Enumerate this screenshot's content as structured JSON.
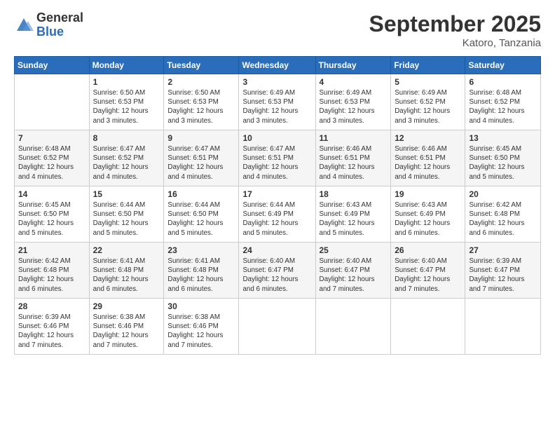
{
  "logo": {
    "general": "General",
    "blue": "Blue"
  },
  "title": "September 2025",
  "location": "Katoro, Tanzania",
  "days_of_week": [
    "Sunday",
    "Monday",
    "Tuesday",
    "Wednesday",
    "Thursday",
    "Friday",
    "Saturday"
  ],
  "weeks": [
    [
      {
        "day": "",
        "info": ""
      },
      {
        "day": "1",
        "info": "Sunrise: 6:50 AM\nSunset: 6:53 PM\nDaylight: 12 hours\nand 3 minutes."
      },
      {
        "day": "2",
        "info": "Sunrise: 6:50 AM\nSunset: 6:53 PM\nDaylight: 12 hours\nand 3 minutes."
      },
      {
        "day": "3",
        "info": "Sunrise: 6:49 AM\nSunset: 6:53 PM\nDaylight: 12 hours\nand 3 minutes."
      },
      {
        "day": "4",
        "info": "Sunrise: 6:49 AM\nSunset: 6:53 PM\nDaylight: 12 hours\nand 3 minutes."
      },
      {
        "day": "5",
        "info": "Sunrise: 6:49 AM\nSunset: 6:52 PM\nDaylight: 12 hours\nand 3 minutes."
      },
      {
        "day": "6",
        "info": "Sunrise: 6:48 AM\nSunset: 6:52 PM\nDaylight: 12 hours\nand 4 minutes."
      }
    ],
    [
      {
        "day": "7",
        "info": "Sunrise: 6:48 AM\nSunset: 6:52 PM\nDaylight: 12 hours\nand 4 minutes."
      },
      {
        "day": "8",
        "info": "Sunrise: 6:47 AM\nSunset: 6:52 PM\nDaylight: 12 hours\nand 4 minutes."
      },
      {
        "day": "9",
        "info": "Sunrise: 6:47 AM\nSunset: 6:51 PM\nDaylight: 12 hours\nand 4 minutes."
      },
      {
        "day": "10",
        "info": "Sunrise: 6:47 AM\nSunset: 6:51 PM\nDaylight: 12 hours\nand 4 minutes."
      },
      {
        "day": "11",
        "info": "Sunrise: 6:46 AM\nSunset: 6:51 PM\nDaylight: 12 hours\nand 4 minutes."
      },
      {
        "day": "12",
        "info": "Sunrise: 6:46 AM\nSunset: 6:51 PM\nDaylight: 12 hours\nand 4 minutes."
      },
      {
        "day": "13",
        "info": "Sunrise: 6:45 AM\nSunset: 6:50 PM\nDaylight: 12 hours\nand 5 minutes."
      }
    ],
    [
      {
        "day": "14",
        "info": "Sunrise: 6:45 AM\nSunset: 6:50 PM\nDaylight: 12 hours\nand 5 minutes."
      },
      {
        "day": "15",
        "info": "Sunrise: 6:44 AM\nSunset: 6:50 PM\nDaylight: 12 hours\nand 5 minutes."
      },
      {
        "day": "16",
        "info": "Sunrise: 6:44 AM\nSunset: 6:50 PM\nDaylight: 12 hours\nand 5 minutes."
      },
      {
        "day": "17",
        "info": "Sunrise: 6:44 AM\nSunset: 6:49 PM\nDaylight: 12 hours\nand 5 minutes."
      },
      {
        "day": "18",
        "info": "Sunrise: 6:43 AM\nSunset: 6:49 PM\nDaylight: 12 hours\nand 5 minutes."
      },
      {
        "day": "19",
        "info": "Sunrise: 6:43 AM\nSunset: 6:49 PM\nDaylight: 12 hours\nand 6 minutes."
      },
      {
        "day": "20",
        "info": "Sunrise: 6:42 AM\nSunset: 6:48 PM\nDaylight: 12 hours\nand 6 minutes."
      }
    ],
    [
      {
        "day": "21",
        "info": "Sunrise: 6:42 AM\nSunset: 6:48 PM\nDaylight: 12 hours\nand 6 minutes."
      },
      {
        "day": "22",
        "info": "Sunrise: 6:41 AM\nSunset: 6:48 PM\nDaylight: 12 hours\nand 6 minutes."
      },
      {
        "day": "23",
        "info": "Sunrise: 6:41 AM\nSunset: 6:48 PM\nDaylight: 12 hours\nand 6 minutes."
      },
      {
        "day": "24",
        "info": "Sunrise: 6:40 AM\nSunset: 6:47 PM\nDaylight: 12 hours\nand 6 minutes."
      },
      {
        "day": "25",
        "info": "Sunrise: 6:40 AM\nSunset: 6:47 PM\nDaylight: 12 hours\nand 7 minutes."
      },
      {
        "day": "26",
        "info": "Sunrise: 6:40 AM\nSunset: 6:47 PM\nDaylight: 12 hours\nand 7 minutes."
      },
      {
        "day": "27",
        "info": "Sunrise: 6:39 AM\nSunset: 6:47 PM\nDaylight: 12 hours\nand 7 minutes."
      }
    ],
    [
      {
        "day": "28",
        "info": "Sunrise: 6:39 AM\nSunset: 6:46 PM\nDaylight: 12 hours\nand 7 minutes."
      },
      {
        "day": "29",
        "info": "Sunrise: 6:38 AM\nSunset: 6:46 PM\nDaylight: 12 hours\nand 7 minutes."
      },
      {
        "day": "30",
        "info": "Sunrise: 6:38 AM\nSunset: 6:46 PM\nDaylight: 12 hours\nand 7 minutes."
      },
      {
        "day": "",
        "info": ""
      },
      {
        "day": "",
        "info": ""
      },
      {
        "day": "",
        "info": ""
      },
      {
        "day": "",
        "info": ""
      }
    ]
  ]
}
